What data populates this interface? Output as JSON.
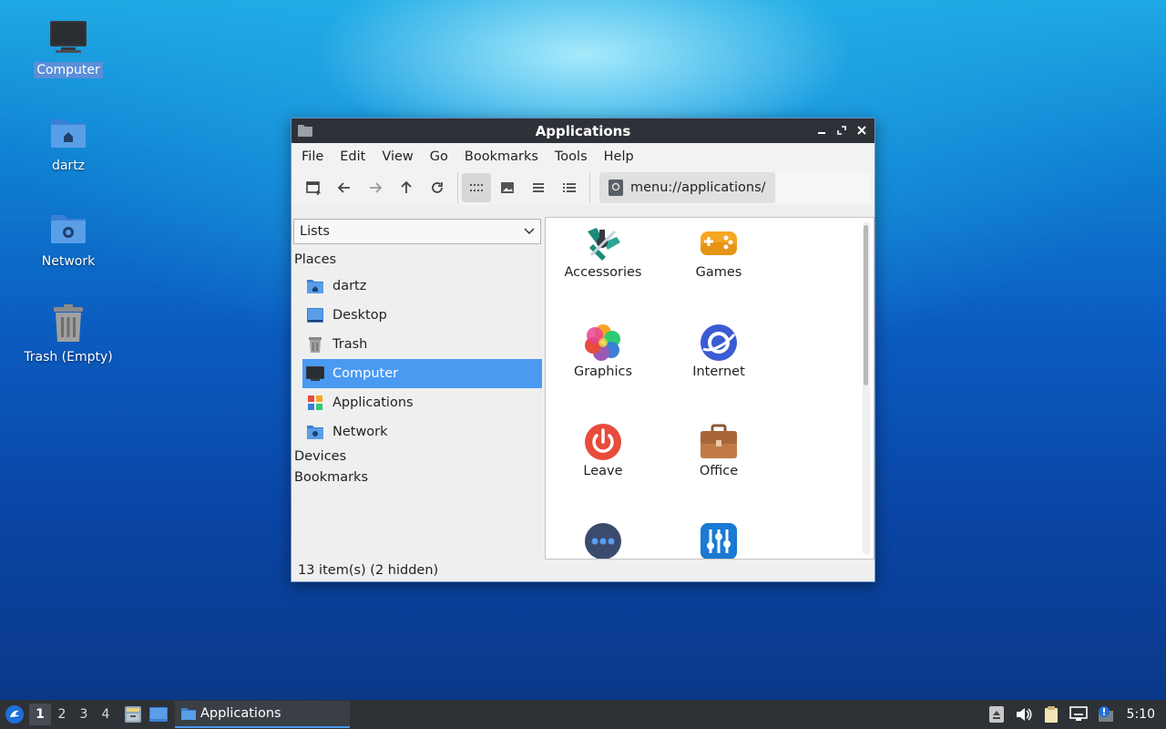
{
  "desktop": {
    "icons": [
      {
        "label": "Computer",
        "icon": "computer-icon"
      },
      {
        "label": "dartz",
        "icon": "home-folder-icon"
      },
      {
        "label": "Network",
        "icon": "network-folder-icon"
      },
      {
        "label": "Trash (Empty)",
        "icon": "trash-icon"
      }
    ]
  },
  "window": {
    "title": "Applications",
    "menu": [
      "File",
      "Edit",
      "View",
      "Go",
      "Bookmarks",
      "Tools",
      "Help"
    ],
    "location": "menu://applications/",
    "side_select": "Lists",
    "sections": {
      "places": "Places",
      "devices": "Devices",
      "bookmarks": "Bookmarks"
    },
    "places": [
      {
        "label": "dartz",
        "icon": "home-folder-icon"
      },
      {
        "label": "Desktop",
        "icon": "desktop-icon"
      },
      {
        "label": "Trash",
        "icon": "trash-icon"
      },
      {
        "label": "Computer",
        "icon": "computer-icon",
        "selected": true
      },
      {
        "label": "Applications",
        "icon": "applications-icon"
      },
      {
        "label": "Network",
        "icon": "network-folder-icon"
      }
    ],
    "apps": [
      {
        "label": "Accessories",
        "icon": "accessories-icon"
      },
      {
        "label": "Games",
        "icon": "gamepad-icon"
      },
      {
        "label": "Graphics",
        "icon": "graphics-icon"
      },
      {
        "label": "Internet",
        "icon": "internet-icon"
      },
      {
        "label": "Leave",
        "icon": "power-icon"
      },
      {
        "label": "Office",
        "icon": "briefcase-icon"
      },
      {
        "label": "",
        "icon": "more-icon"
      },
      {
        "label": "",
        "icon": "settings-sliders-icon"
      }
    ],
    "status": "13 item(s) (2 hidden)"
  },
  "taskbar": {
    "workspaces": [
      "1",
      "2",
      "3",
      "4"
    ],
    "active_task": "Applications",
    "clock": "5:10"
  },
  "colors": {
    "selection": "#4a9af2",
    "titlebar": "#2e3238",
    "taskbar": "#2e3136"
  }
}
